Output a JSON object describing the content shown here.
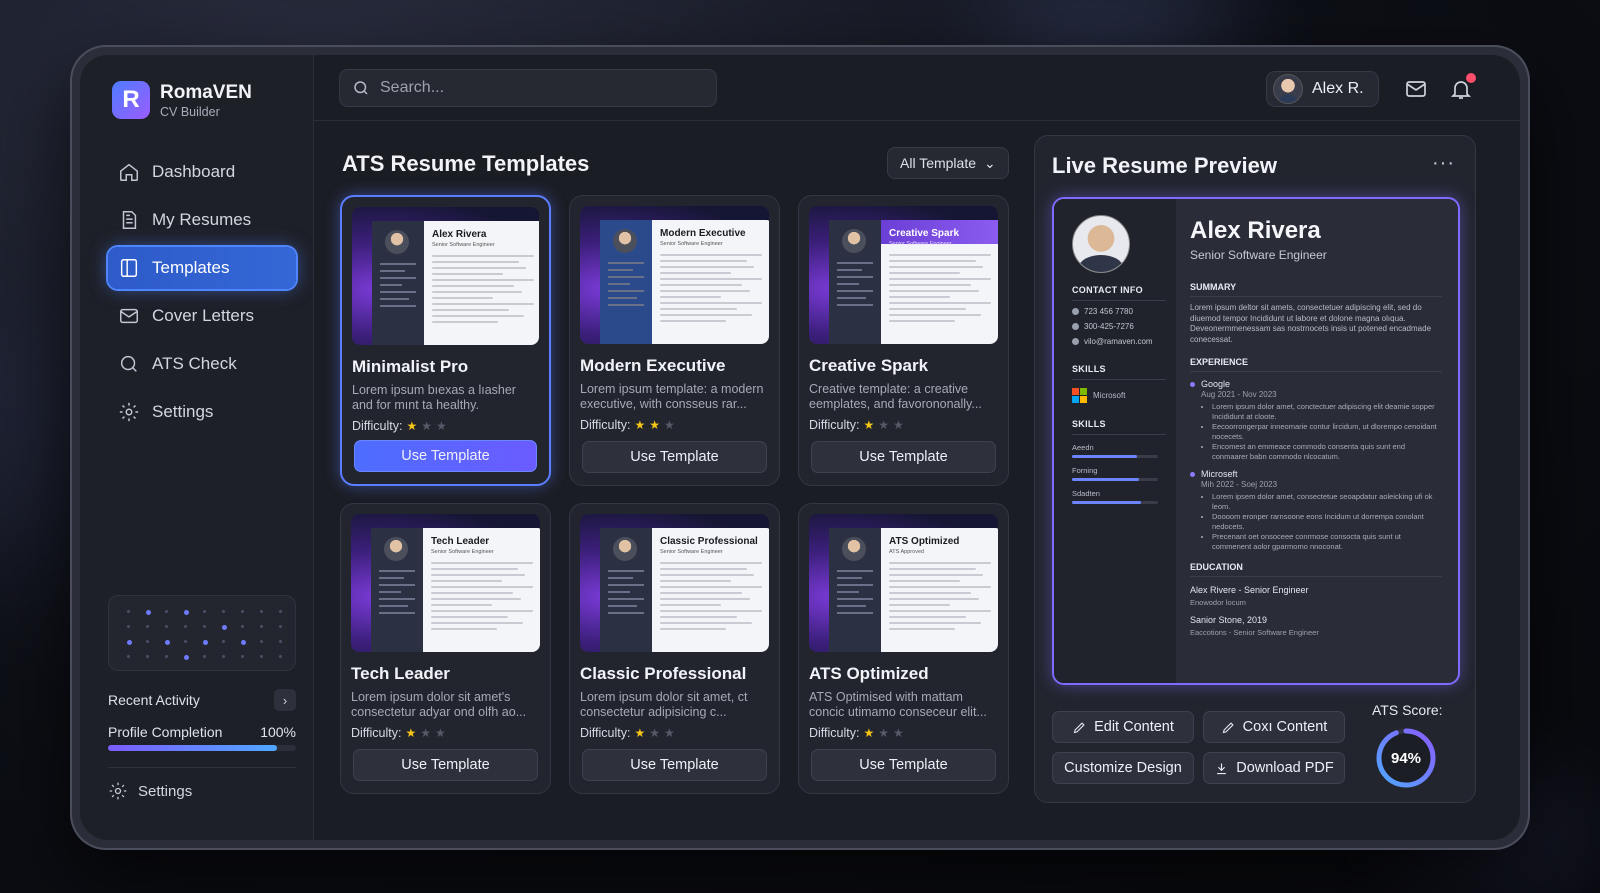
{
  "brand": {
    "logo_letter": "R",
    "name": "RomaVEN",
    "subtitle": "CV Builder"
  },
  "nav": [
    {
      "label": "Dashboard",
      "icon": "home-icon",
      "active": false
    },
    {
      "label": "My Resumes",
      "icon": "document-icon",
      "active": false
    },
    {
      "label": "Templates",
      "icon": "template-icon",
      "active": true
    },
    {
      "label": "Cover Letters",
      "icon": "mail-icon",
      "active": false
    },
    {
      "label": "ATS Check",
      "icon": "search-icon",
      "active": false
    },
    {
      "label": "Settings",
      "icon": "gear-icon",
      "active": false
    }
  ],
  "sidebar_bottom": {
    "recent_activity": "Recent Activity",
    "recent_chevron": "›",
    "profile_completion_label": "Profile Completion",
    "profile_completion_value": "100%",
    "profile_completion_fraction": 0.9,
    "settings_label": "Settings"
  },
  "search": {
    "placeholder": "Search..."
  },
  "user": {
    "name": "Alex R."
  },
  "templates_section": {
    "title": "ATS Resume Templates",
    "filter_label": "All Template",
    "filter_chevron": "⌄",
    "difficulty_label": "Difficulty:",
    "cards": [
      {
        "title": "Minimalist Pro",
        "desc": "Lorem ipsum bıexas a lıasher and for mınt ta healthy.",
        "stars": 1,
        "button": "Use Template",
        "selected": true,
        "thumb_name": "Alex Rivera",
        "thumb_role": "Senior Software Engineer",
        "variant": "plain"
      },
      {
        "title": "Modern Executive",
        "desc": "Lorem ipsum template: a modern executive, with consseus rar...",
        "stars": 2,
        "button": "Use Template",
        "selected": false,
        "thumb_name": "Modern Executive",
        "thumb_role": "Senior Software Engineer",
        "variant": "blue-side"
      },
      {
        "title": "Creative Spark",
        "desc": "Creative template: a creative eemplates, and favorononally...",
        "stars": 1,
        "button": "Use Template",
        "selected": false,
        "thumb_name": "Creative Spark",
        "thumb_role": "Senior Software Engineer",
        "variant": "purple-head"
      },
      {
        "title": "Tech Leader",
        "desc": "Lorem ipsum dolor sit amet's consectetur adyar ond olfh ao...",
        "stars": 1,
        "button": "Use Template",
        "selected": false,
        "thumb_name": "Tech Leader",
        "thumb_role": "Senior Software Engineer",
        "variant": "plain"
      },
      {
        "title": "Classic Professional",
        "desc": "Lorem ipsum dolor sit amet, ct consectetur adipisicing c...",
        "stars": 1,
        "button": "Use Template",
        "selected": false,
        "thumb_name": "Classic Professional",
        "thumb_role": "Senior Software Engineer",
        "variant": "plain"
      },
      {
        "title": "ATS Optimized",
        "desc": "ATS Optimised with mattam concic utimamo conseceur elit...",
        "stars": 1,
        "button": "Use Template",
        "selected": false,
        "thumb_name": "ATS Optimized",
        "thumb_role": "ATS Approved",
        "variant": "plain"
      }
    ]
  },
  "preview": {
    "title": "Live Resume Preview",
    "more": "···",
    "resume": {
      "name": "Alex Rivera",
      "role": "Senior Software Engineer",
      "contact_heading": "CONTACT INFO",
      "contacts": [
        "723 456 7780",
        "300-425-7276",
        "vilo@ramaven.com"
      ],
      "skills_heading_1": "SKILLS",
      "skills_company": "Microsoft",
      "skills_heading_2": "SKILLS",
      "skills": [
        {
          "name": "Aeedn",
          "level": 0.75
        },
        {
          "name": "Forning",
          "level": 0.78
        },
        {
          "name": "Sdadten",
          "level": 0.8
        }
      ],
      "summary_heading": "SUMMARY",
      "summary": "Lorem ipsum deltor sit amets, consectetuer adipiscing elit, sed do diuemod tempor Incididunt ut labore et dolone magna olıqua. Deveonermmenessam sas nostrnocets insis ut potened encadmade conecessat.",
      "experience_heading": "EXPERIENCE",
      "jobs": [
        {
          "company": "Google",
          "dates": "Aug 2021 - Nov 2023",
          "bullets": [
            "Lorem ipsum dolor amet, conctectuer adipiscing elit deamie sopper Incididunt at cloote.",
            "Eecoorrongerpar inneomarie contur lircidum, ut dlorempo cenoidant nocecets.",
            "Encomest an emmeace commodo consenta quis sunt end conmaarer babn commodo nlcocatum."
          ]
        },
        {
          "company": "Microseft",
          "dates": "Mih 2022 - Soej 2023",
          "bullets": [
            "Lorem ipsem dolor amet, consectetue seoapdatur aoleicking ufi ok leom.",
            "Doooom eronper rarnsoone eons Incidum ut dorrempa conolant nedocets.",
            "Precenant oet onsoceee conrmose consocta quis sunt ut commenent aolor gparmomo nnoconat."
          ]
        }
      ],
      "education_heading": "EDUCATION",
      "education": [
        {
          "title": "Alex Rivere - Senior Engineer",
          "sub": "Enowodor locum"
        },
        {
          "title": "Sanior Stone, 2019",
          "sub": "Eaccotions - Senior Software Engineer"
        }
      ]
    },
    "actions": {
      "edit": "Edit Content",
      "copy": "Coxı Content",
      "customize": "Customize Design",
      "download": "Download PDF"
    },
    "ats_label": "ATS Score:",
    "ats_value": "94%",
    "ats_fraction": 0.94
  }
}
